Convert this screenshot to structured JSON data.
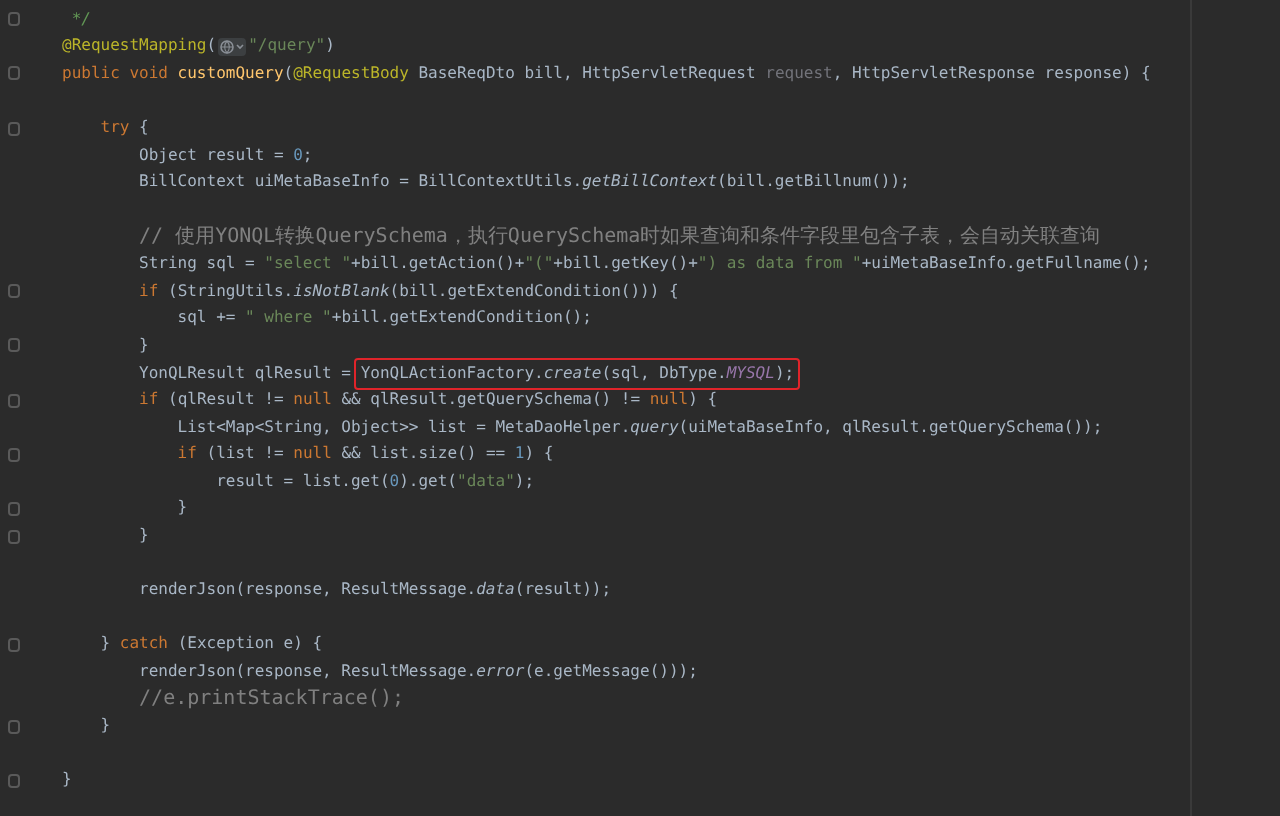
{
  "lines": [
    {
      "fold": true,
      "tokens": [
        {
          "kind": "doc",
          "text": " */"
        }
      ]
    },
    {
      "fold": false,
      "tokens": [
        {
          "kind": "ann",
          "text": "@RequestMapping"
        },
        {
          "kind": "plain",
          "text": "("
        },
        {
          "kind": "inlay"
        },
        {
          "kind": "str",
          "text": "\"/query\""
        },
        {
          "kind": "plain",
          "text": ")"
        }
      ]
    },
    {
      "fold": true,
      "tokens": [
        {
          "kind": "kw",
          "text": "public void "
        },
        {
          "kind": "decl",
          "text": "customQuery"
        },
        {
          "kind": "plain",
          "text": "("
        },
        {
          "kind": "ann",
          "text": "@RequestBody"
        },
        {
          "kind": "plain",
          "text": " BaseReqDto bill, HttpServletRequest "
        },
        {
          "kind": "dim",
          "text": "request"
        },
        {
          "kind": "plain",
          "text": ", HttpServletResponse response) {"
        }
      ]
    },
    {
      "fold": false
    },
    {
      "fold": true,
      "tokens": [
        {
          "kind": "kw",
          "text": "    try"
        },
        {
          "kind": "plain",
          "text": " {"
        }
      ]
    },
    {
      "fold": false,
      "tokens": [
        {
          "kind": "plain",
          "text": "        Object result = "
        },
        {
          "kind": "num",
          "text": "0"
        },
        {
          "kind": "plain",
          "text": ";"
        }
      ]
    },
    {
      "fold": false,
      "tokens": [
        {
          "kind": "plain",
          "text": "        BillContext uiMetaBaseInfo = BillContextUtils."
        },
        {
          "kind": "static",
          "text": "getBillContext"
        },
        {
          "kind": "plain",
          "text": "(bill.getBillnum());"
        }
      ]
    },
    {
      "fold": false
    },
    {
      "fold": false,
      "tokens": [
        {
          "kind": "comment",
          "text": "        // 使用YONQL转换QuerySchema，执行QuerySchema时如果查询和条件字段里包含子表，会自动关联查询"
        }
      ]
    },
    {
      "fold": false,
      "tokens": [
        {
          "kind": "plain",
          "text": "        String sql = "
        },
        {
          "kind": "str",
          "text": "\"select \""
        },
        {
          "kind": "plain",
          "text": "+bill.getAction()+"
        },
        {
          "kind": "str",
          "text": "\"(\""
        },
        {
          "kind": "plain",
          "text": "+bill.getKey()+"
        },
        {
          "kind": "str",
          "text": "\") as data from \""
        },
        {
          "kind": "plain",
          "text": "+uiMetaBaseInfo.getFullname();"
        }
      ]
    },
    {
      "fold": true,
      "tokens": [
        {
          "kind": "kw",
          "text": "        if"
        },
        {
          "kind": "plain",
          "text": " (StringUtils."
        },
        {
          "kind": "static",
          "text": "isNotBlank"
        },
        {
          "kind": "plain",
          "text": "(bill.getExtendCondition())) {"
        }
      ]
    },
    {
      "fold": false,
      "tokens": [
        {
          "kind": "plain",
          "text": "            sql += "
        },
        {
          "kind": "str",
          "text": "\" where \""
        },
        {
          "kind": "plain",
          "text": "+bill.getExtendCondition();"
        }
      ]
    },
    {
      "fold": true,
      "tokens": [
        {
          "kind": "plain",
          "text": "        }"
        }
      ]
    },
    {
      "fold": false,
      "tokens": [
        {
          "kind": "plain",
          "text": "        YonQLResult qlResult = "
        },
        {
          "kind": "plain",
          "text": "YonQLActionFactory.",
          "boxed": true
        },
        {
          "kind": "static",
          "text": "create",
          "boxed": true
        },
        {
          "kind": "plain",
          "text": "(sql, DbType.",
          "boxed": true
        },
        {
          "kind": "const",
          "text": "MYSQL",
          "boxed": true
        },
        {
          "kind": "plain",
          "text": ");",
          "boxed": true
        }
      ]
    },
    {
      "fold": true,
      "tokens": [
        {
          "kind": "kw",
          "text": "        if"
        },
        {
          "kind": "plain",
          "text": " (qlResult != "
        },
        {
          "kind": "kw",
          "text": "null"
        },
        {
          "kind": "plain",
          "text": " && qlResult.getQuerySchema() != "
        },
        {
          "kind": "kw",
          "text": "null"
        },
        {
          "kind": "plain",
          "text": ") {"
        }
      ]
    },
    {
      "fold": false,
      "tokens": [
        {
          "kind": "plain",
          "text": "            List<Map<String, Object>> list = MetaDaoHelper."
        },
        {
          "kind": "static",
          "text": "query"
        },
        {
          "kind": "plain",
          "text": "(uiMetaBaseInfo, qlResult.getQuerySchema());"
        }
      ]
    },
    {
      "fold": true,
      "tokens": [
        {
          "kind": "kw",
          "text": "            if"
        },
        {
          "kind": "plain",
          "text": " (list != "
        },
        {
          "kind": "kw",
          "text": "null"
        },
        {
          "kind": "plain",
          "text": " && list.size() == "
        },
        {
          "kind": "num",
          "text": "1"
        },
        {
          "kind": "plain",
          "text": ") {"
        }
      ]
    },
    {
      "fold": false,
      "tokens": [
        {
          "kind": "plain",
          "text": "                result = list.get("
        },
        {
          "kind": "num",
          "text": "0"
        },
        {
          "kind": "plain",
          "text": ").get("
        },
        {
          "kind": "str",
          "text": "\"data\""
        },
        {
          "kind": "plain",
          "text": ");"
        }
      ]
    },
    {
      "fold": true,
      "tokens": [
        {
          "kind": "plain",
          "text": "            }"
        }
      ]
    },
    {
      "fold": true,
      "tokens": [
        {
          "kind": "plain",
          "text": "        }"
        }
      ]
    },
    {
      "fold": false
    },
    {
      "fold": false,
      "tokens": [
        {
          "kind": "plain",
          "text": "        renderJson(response, ResultMessage."
        },
        {
          "kind": "static",
          "text": "data"
        },
        {
          "kind": "plain",
          "text": "(result));"
        }
      ]
    },
    {
      "fold": false
    },
    {
      "fold": true,
      "tokens": [
        {
          "kind": "plain",
          "text": "    } "
        },
        {
          "kind": "kw",
          "text": "catch"
        },
        {
          "kind": "plain",
          "text": " (Exception e) {"
        }
      ]
    },
    {
      "fold": false,
      "tokens": [
        {
          "kind": "plain",
          "text": "        renderJson(response, ResultMessage."
        },
        {
          "kind": "static",
          "text": "error"
        },
        {
          "kind": "plain",
          "text": "(e.getMessage()));"
        }
      ]
    },
    {
      "fold": false,
      "tokens": [
        {
          "kind": "comment",
          "text": "        //e.printStackTrace();"
        }
      ]
    },
    {
      "fold": true,
      "tokens": [
        {
          "kind": "plain",
          "text": "    }"
        }
      ]
    },
    {
      "fold": false
    },
    {
      "fold": true,
      "tokens": [
        {
          "kind": "plain",
          "text": "}"
        }
      ]
    }
  ]
}
